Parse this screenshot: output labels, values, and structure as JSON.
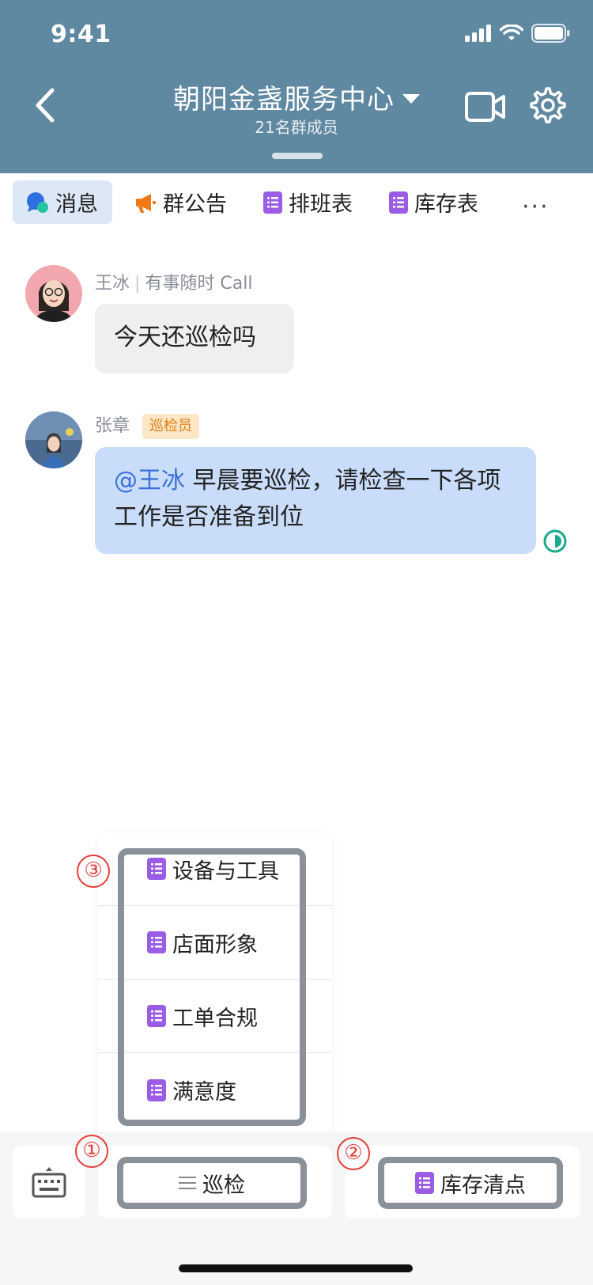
{
  "status_bar": {
    "time": "9:41"
  },
  "header": {
    "group_name": "朝阳金盏服务中心",
    "member_count": "21名群成员",
    "icons": {
      "back": "chevron-left-icon",
      "dropdown": "caret-down-icon",
      "video": "video-camera-icon",
      "settings": "gear-icon"
    }
  },
  "tabs": [
    {
      "label": "消息",
      "icon": "chat-bubble-icon",
      "active": true
    },
    {
      "label": "群公告",
      "icon": "megaphone-icon",
      "active": false
    },
    {
      "label": "排班表",
      "icon": "doc-icon",
      "active": false
    },
    {
      "label": "库存表",
      "icon": "doc-icon",
      "active": false
    }
  ],
  "more_label": "···",
  "messages": [
    {
      "sender": "王冰",
      "signature": "有事随时 Call",
      "text": "今天还巡检吗"
    },
    {
      "sender": "张章",
      "role": "巡检员",
      "mention": "@王冰",
      "text": " 早晨要巡检，请检查一下各项工作是否准备到位"
    }
  ],
  "popup_menu": {
    "items": [
      "设备与工具",
      "店面形象",
      "工单合规",
      "满意度"
    ]
  },
  "bottom_bar": {
    "menu_button": "巡检",
    "doc_button": "库存清点"
  },
  "markers": {
    "m1": "①",
    "m2": "②",
    "m3": "③"
  },
  "colors": {
    "header": "#5f88a1",
    "accent_blue": "#3a70d6",
    "doc_purple": "#9b5de5",
    "badge_orange": "#e17c12",
    "marker_red": "#e5403b",
    "frame_gray": "#8b9199"
  }
}
